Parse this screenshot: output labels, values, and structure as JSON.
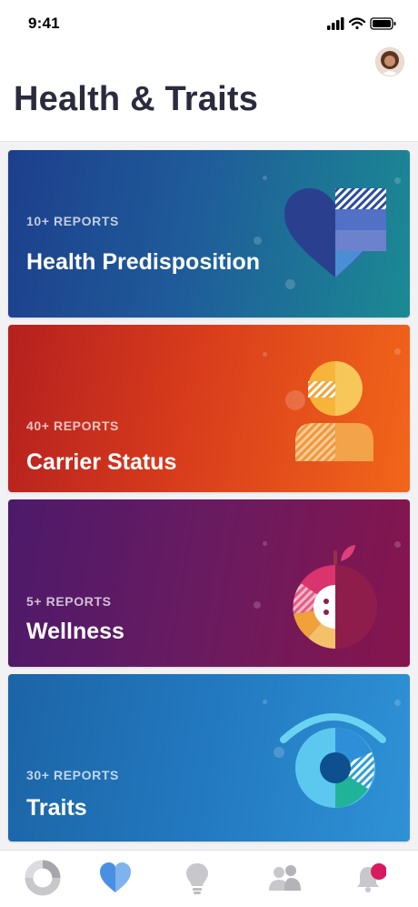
{
  "status_bar": {
    "time": "9:41",
    "icons": [
      "cellular-signal-icon",
      "wifi-icon",
      "battery-icon"
    ]
  },
  "header": {
    "title": "Health & Traits",
    "avatar": "profile-avatar"
  },
  "cards": [
    {
      "count": "10+ REPORTS",
      "name": "Health Predisposition",
      "icon": "heart-icon"
    },
    {
      "count": "40+ REPORTS",
      "name": "Carrier Status",
      "icon": "person-icon"
    },
    {
      "count": "5+ REPORTS",
      "name": "Wellness",
      "icon": "apple-icon"
    },
    {
      "count": "30+ REPORTS",
      "name": "Traits",
      "icon": "eye-icon"
    }
  ],
  "tabbar": {
    "tabs": [
      "ancestry-tab",
      "health-tab",
      "insights-tab",
      "relatives-tab",
      "notifications-tab"
    ],
    "active": "health-tab",
    "notification_badge_color": "#d81b60"
  },
  "colors": {
    "health": "#1d4f92",
    "carrier": "#d8391b",
    "wellness": "#6a1b60",
    "traits": "#2379c0",
    "tab_active": "#4a90e2",
    "tab_inactive": "#c8c8cc"
  }
}
